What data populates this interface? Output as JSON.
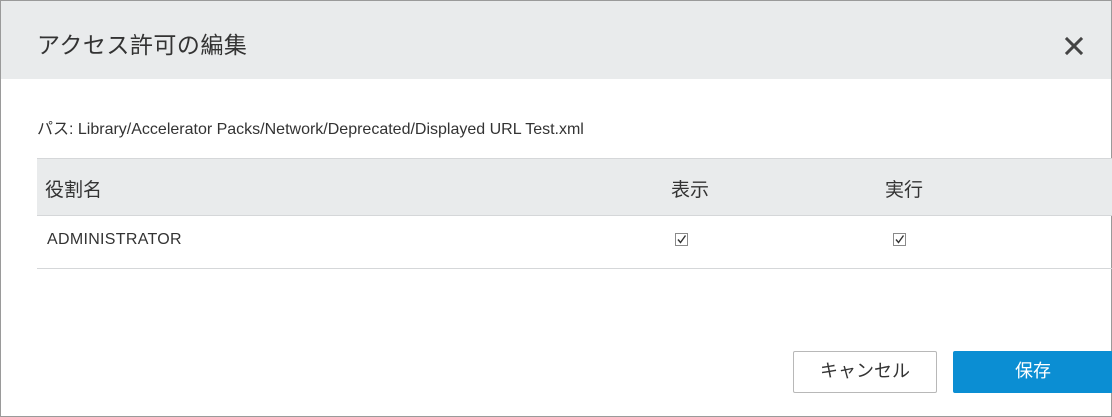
{
  "dialog": {
    "title": "アクセス許可の編集",
    "path": "パス: Library/Accelerator Packs/Network/Deprecated/Displayed URL Test.xml"
  },
  "table": {
    "headers": {
      "role": "役割名",
      "view": "表示",
      "execute": "実行"
    },
    "rows": [
      {
        "role": "ADMINISTRATOR",
        "view": true,
        "execute": true
      }
    ]
  },
  "buttons": {
    "cancel": "キャンセル",
    "save": "保存"
  },
  "colors": {
    "accent": "#0b8ed3",
    "header_bg": "#e9ebec"
  }
}
